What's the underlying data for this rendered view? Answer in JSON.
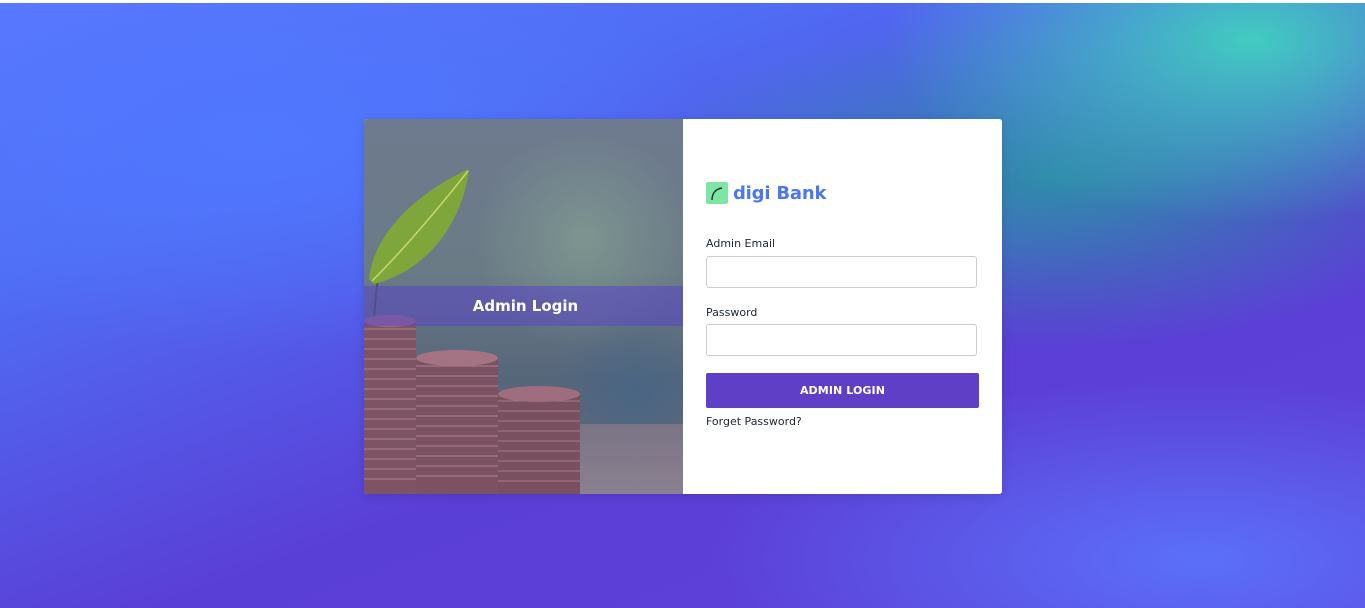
{
  "login_card": {
    "hero_banner_text": "Admin Login",
    "logo_text": "digi Bank",
    "email_label": "Admin Email",
    "email_value": "",
    "password_label": "Password",
    "password_value": "",
    "submit_label": "ADMIN LOGIN",
    "forgot_link": "Forget Password?"
  },
  "colors": {
    "accent": "#5f3fc6",
    "logo_text": "#4a78f0",
    "logo_mark": "#7ee6a5",
    "banner_overlay": "#5a46c8"
  },
  "icons": {
    "logo_mark": "digi-bank-logo-icon",
    "hero_image": "plant-and-coins-illustration"
  }
}
